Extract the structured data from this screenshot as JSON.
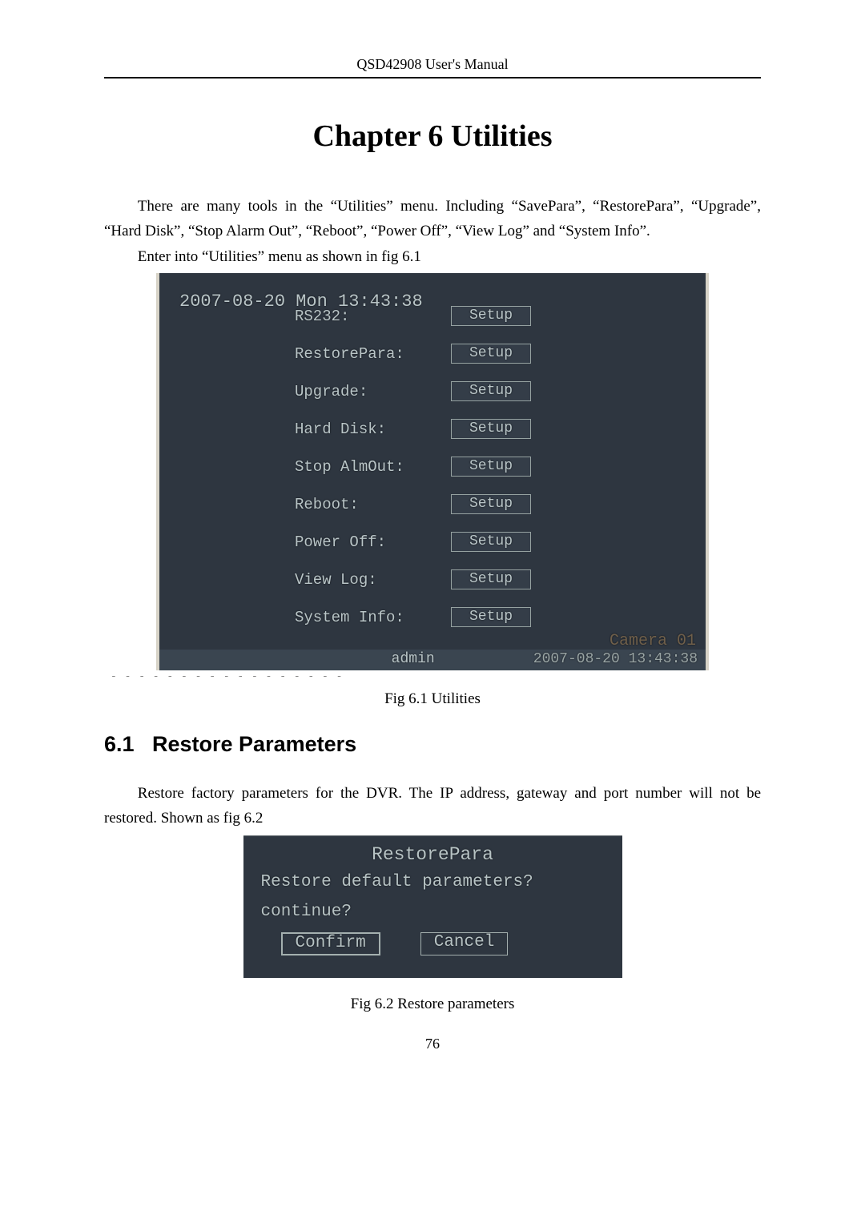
{
  "header": "QSD42908 User's Manual",
  "chapter_title": "Chapter 6  Utilities",
  "intro": "There are many tools in the “Utilities” menu. Including “SavePara”, “RestorePara”, “Upgrade”, “Hard Disk”, “Stop Alarm Out”, “Reboot”, “Power Off”, “View Log” and “System Info”.",
  "enter_line": "Enter into “Utilities” menu as shown in fig 6.1",
  "scr1": {
    "timestamp_top": "2007-08-20 Mon 13:43:38",
    "button_label": "Setup",
    "rows": [
      "RS232:",
      "RestorePara:",
      "Upgrade:",
      "Hard Disk:",
      "Stop AlmOut:",
      "Reboot:",
      "Power Off:",
      "View Log:",
      "System Info:"
    ],
    "camera_label": "Camera 01",
    "admin_label": "admin",
    "timestamp_bottom": "2007-08-20 13:43:38"
  },
  "fig1_caption": "Fig 6.1 Utilities",
  "section": {
    "num": "6.1",
    "title": "Restore Parameters"
  },
  "section_para": "Restore factory parameters for the DVR. The IP address, gateway and port number will not be restored. Shown as fig 6.2",
  "scr2": {
    "title": "RestorePara",
    "line1": "Restore default parameters?",
    "line2": "continue?",
    "confirm": "Confirm",
    "cancel": "Cancel"
  },
  "fig2_caption": "Fig 6.2 Restore parameters",
  "page_number": "76"
}
